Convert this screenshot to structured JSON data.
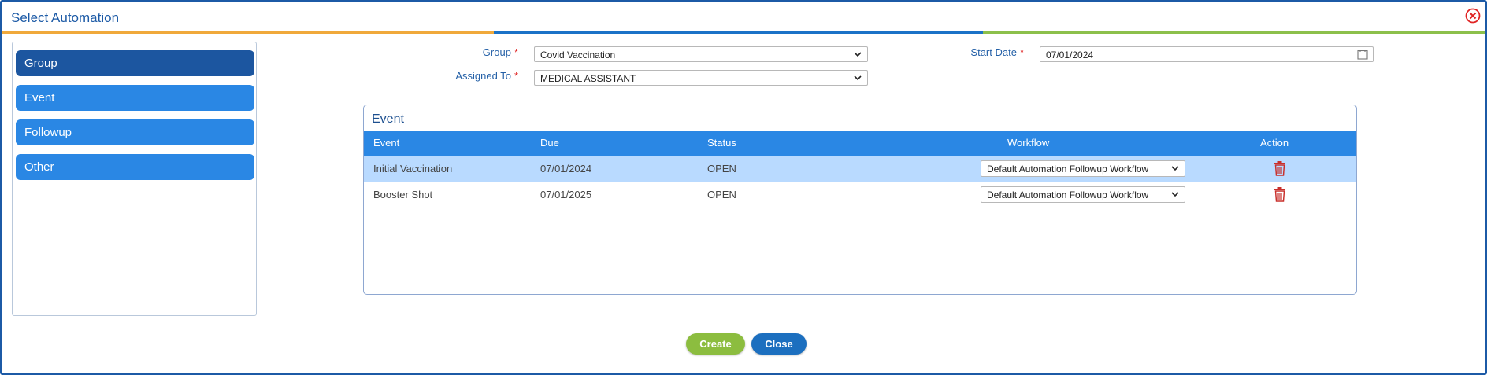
{
  "dialog": {
    "title": "Select Automation",
    "close_icon": "circle-x-icon"
  },
  "colors": {
    "accent": "#1c5aa6",
    "sidebar_item": "#2a87e4",
    "sidebar_active": "#1c56a0",
    "stripe_orange": "#f0a93b",
    "stripe_blue": "#1b72c7",
    "stripe_green": "#8cc04b",
    "required": "#e02424",
    "delete": "#c9302c"
  },
  "sidebar": {
    "items": [
      {
        "label": "Group",
        "active": true
      },
      {
        "label": "Event",
        "active": false
      },
      {
        "label": "Followup",
        "active": false
      },
      {
        "label": "Other",
        "active": false
      }
    ]
  },
  "form": {
    "group_label": "Group",
    "group_value": "Covid Vaccination",
    "assigned_label": "Assigned To",
    "assigned_value": "MEDICAL ASSISTANT",
    "start_date_label": "Start Date",
    "start_date_value": "07/01/2024",
    "required_mark": "*"
  },
  "event_panel": {
    "title": "Event",
    "columns": [
      "Event",
      "Due",
      "Status",
      "Workflow",
      "Action"
    ],
    "rows": [
      {
        "event": "Initial Vaccination",
        "due": "07/01/2024",
        "status": "OPEN",
        "workflow": "Default Automation Followup Workflow",
        "action_icon": "trash-icon"
      },
      {
        "event": "Booster Shot",
        "due": "07/01/2025",
        "status": "OPEN",
        "workflow": "Default Automation Followup Workflow",
        "action_icon": "trash-icon"
      }
    ]
  },
  "buttons": {
    "create": "Create",
    "close": "Close"
  }
}
